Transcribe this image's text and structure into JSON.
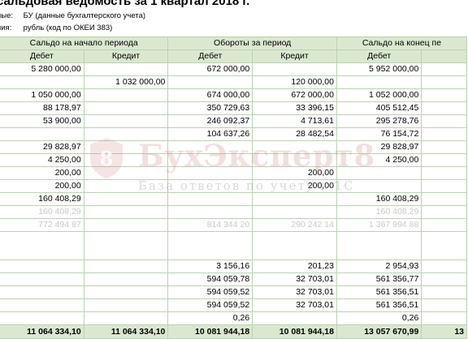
{
  "title": "сальдовая ведомость за 1 квартал 2018 г.",
  "meta": [
    {
      "key": "ные:",
      "value": "БУ (данные бухгалтерского учета)"
    },
    {
      "key": "ния:",
      "value": "рубль (код по ОКЕИ 383)"
    }
  ],
  "headers": {
    "groups": [
      "Сальдо на начало периода",
      "Обороты за период",
      "Сальдо на конец пе"
    ],
    "sub": [
      "Дебет",
      "Кредит",
      "Дебет",
      "Кредит",
      "Дебет",
      ""
    ]
  },
  "rows": [
    [
      "5 280 000,00",
      "",
      "672 000,00",
      "",
      "5 952 000,00",
      ""
    ],
    [
      "",
      "1 032 000,00",
      "",
      "120 000,00",
      "",
      ""
    ],
    [
      "1 050 000,00",
      "",
      "674 000,00",
      "672 000,00",
      "1 052 000,00",
      ""
    ],
    [
      "88 178,97",
      "",
      "350 729,63",
      "33 396,15",
      "405 512,45",
      ""
    ],
    [
      "53 900,00",
      "",
      "246 092,37",
      "4 713,61",
      "295 278,76",
      ""
    ],
    [
      "",
      "",
      "104 637,26",
      "28 482,54",
      "76 154,72",
      ""
    ],
    [
      "29 828,97",
      "",
      "",
      "",
      "29 828,97",
      ""
    ],
    [
      "4 250,00",
      "",
      "",
      "",
      "4 250,00",
      ""
    ],
    [
      "200,00",
      "",
      "",
      "200,00",
      "",
      ""
    ],
    [
      "200,00",
      "",
      "",
      "200,00",
      "",
      ""
    ],
    [
      "160 408,29",
      "",
      "",
      "",
      "160 408,29",
      ""
    ]
  ],
  "faded_rows": [
    [
      "160 408,29",
      "",
      "",
      "",
      "160 408,29",
      ""
    ],
    [
      "772 494 87",
      "",
      "814 344 20",
      "290 242 14",
      "1 367 994 88",
      ""
    ]
  ],
  "rows_bottom": [
    [
      "",
      "",
      "3 156,16",
      "201,23",
      "2 954,93",
      ""
    ],
    [
      "",
      "",
      "594 059,78",
      "32 703,01",
      "561 356,77",
      ""
    ],
    [
      "",
      "",
      "594 059,52",
      "32 703,01",
      "561 356,51",
      ""
    ],
    [
      "",
      "",
      "594 059,52",
      "32 703,01",
      "561 356,51",
      ""
    ],
    [
      "",
      "",
      "0,26",
      "",
      "0,26",
      ""
    ]
  ],
  "totals": [
    "11 064 334,10",
    "11 064 334,10",
    "10 081 944,18",
    "10 081 944,18",
    "13 057 670,99",
    "13"
  ],
  "watermark": {
    "name": "БухЭксперт8",
    "sub": "База ответов по учету в 1С",
    "logo_text": "8"
  },
  "colors": {
    "header_bg": "#dbe8d0",
    "grid": "#b9d3b0",
    "watermark": "#d28c8c"
  }
}
